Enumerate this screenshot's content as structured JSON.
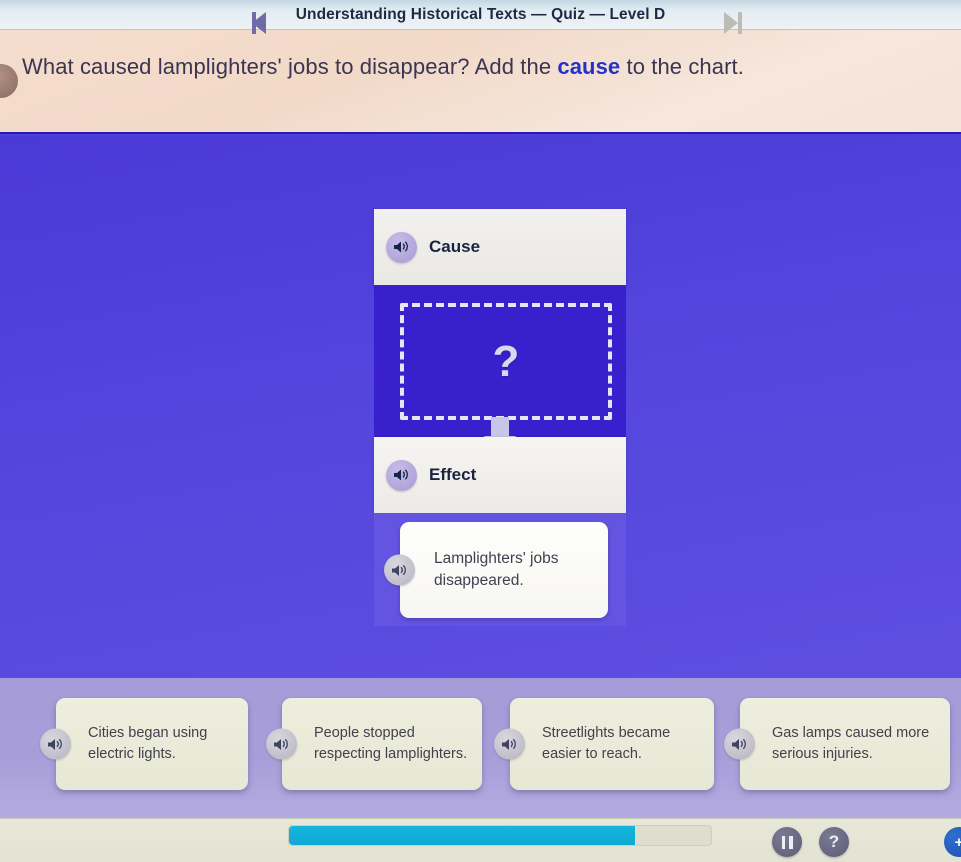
{
  "titlebar": {
    "title": "Understanding Historical Texts — Quiz — Level D"
  },
  "question": {
    "prefix": "What caused lamplighters' jobs to disappear? Add the ",
    "highlight": "cause",
    "suffix": " to the chart.",
    "speaker_icon": "speaker-icon"
  },
  "chart": {
    "cause": {
      "label": "Cause",
      "speaker_icon": "speaker-icon",
      "dropzone_placeholder": "?"
    },
    "effect": {
      "label": "Effect",
      "speaker_icon": "speaker-icon",
      "card_text": "Lamplighters' jobs disappeared."
    },
    "arrow": "arrow-down-icon"
  },
  "options": [
    {
      "label": "Cities began using electric lights.",
      "speaker_icon": "speaker-icon"
    },
    {
      "label": "People stopped respecting lamplighters.",
      "speaker_icon": "speaker-icon"
    },
    {
      "label": "Streetlights became easier to reach.",
      "speaker_icon": "speaker-icon"
    },
    {
      "label": "Gas lamps caused more serious injuries.",
      "speaker_icon": "speaker-icon"
    }
  ],
  "player": {
    "prev_icon": "skip-previous-icon",
    "next_icon": "skip-next-icon",
    "pause_icon": "pause-icon",
    "help_label": "?",
    "edge_label": "+",
    "progress_percent": 82
  },
  "colors": {
    "stage_background": "#4e3fd8",
    "cause_panel": "#3a20cc",
    "effect_panel": "#6354e2",
    "tray_background": "#a79ed9",
    "progress_fill": "#0fa9d4",
    "highlight_text": "#2432c9",
    "banner_background": "#f2d9c8"
  }
}
